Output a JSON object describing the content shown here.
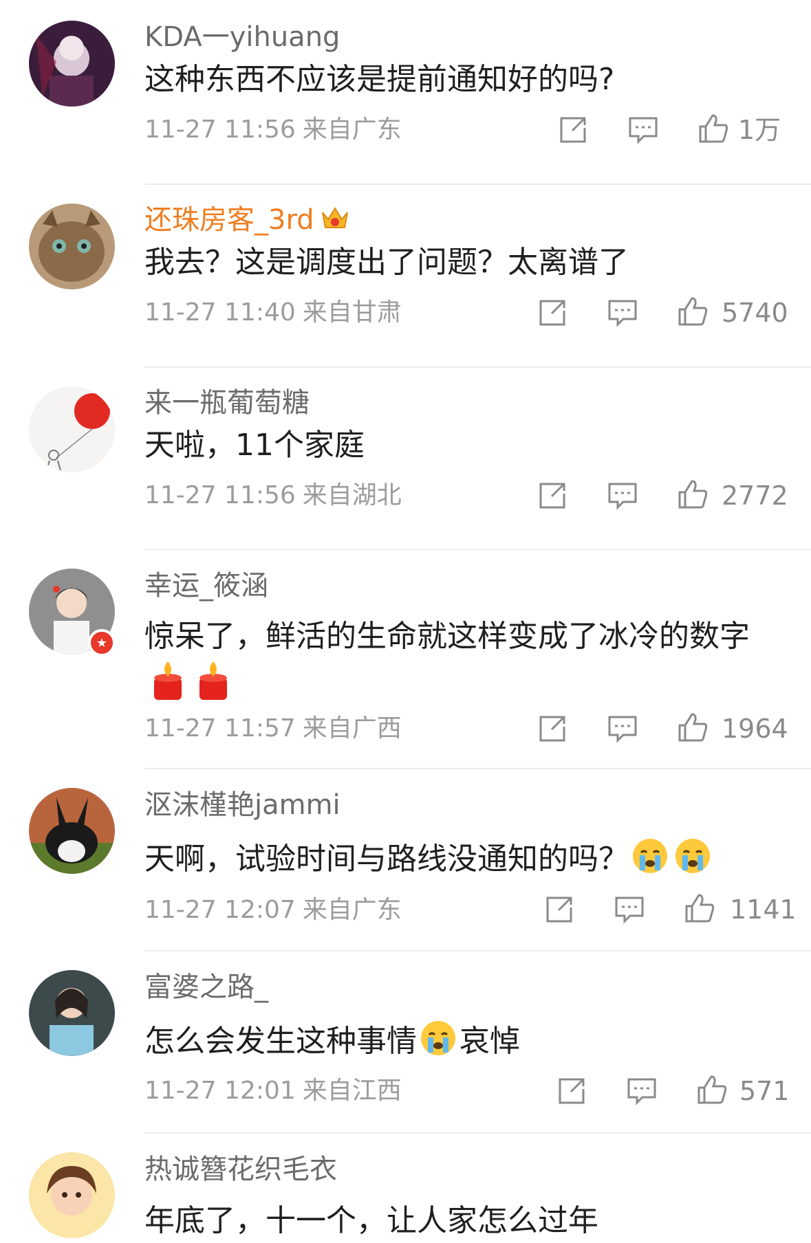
{
  "colors": {
    "vip_name": "#f07d1f",
    "text": "#1f1f1f",
    "meta": "#9c9c9c",
    "divider": "#ececec"
  },
  "icons": {
    "repost": "repost-icon",
    "comment": "comment-icon",
    "like": "like-icon"
  },
  "comments": [
    {
      "name": "KDA一yihuang",
      "text": "这种东西不应该是提前通知好的吗?",
      "time": "11-27 11:56",
      "location": "来自广东",
      "likes": "1万"
    },
    {
      "name": "还珠房客_3rd",
      "text": "我去？这是调度出了问题？太离谱了",
      "time": "11-27 11:40",
      "location": "来自甘肃",
      "likes": "5740"
    },
    {
      "name": "来一瓶葡萄糖",
      "text": "天啦，11个家庭",
      "time": "11-27 11:56",
      "location": "来自湖北",
      "likes": "2772"
    },
    {
      "name": "幸运_筱涵",
      "text": "惊呆了，鲜活的生命就这样变成了冰冷的数字",
      "time": "11-27 11:57",
      "location": "来自广西",
      "likes": "1964"
    },
    {
      "name": "沤沫槿艳jammi",
      "text": "天啊，试验时间与路线没通知的吗？",
      "time": "11-27 12:07",
      "location": "来自广东",
      "likes": "1141"
    },
    {
      "name": "富婆之路_",
      "text": "怎么会发生这种事情",
      "text_after": "哀悼",
      "time": "11-27 12:01",
      "location": "来自江西",
      "likes": "571"
    },
    {
      "name": "热诚簪花织毛衣",
      "text": "年底了，十一个，让人家怎么过年"
    }
  ]
}
